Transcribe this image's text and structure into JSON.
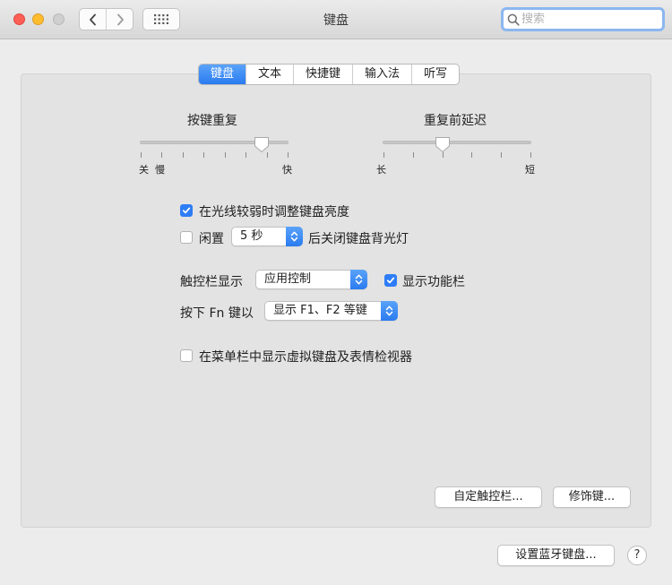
{
  "window": {
    "title": "键盘"
  },
  "toolbar": {
    "back_icon": "chevron-left-icon",
    "forward_icon": "chevron-right-icon",
    "grid_icon": "grid-icon",
    "search": {
      "placeholder": "搜索",
      "value": ""
    }
  },
  "tabs": [
    {
      "label": "键盘",
      "active": true
    },
    {
      "label": "文本",
      "active": false
    },
    {
      "label": "快捷键",
      "active": false
    },
    {
      "label": "输入法",
      "active": false
    },
    {
      "label": "听写",
      "active": false
    }
  ],
  "key_repeat": {
    "label": "按键重复",
    "min_label_1": "关",
    "min_label_2": "慢",
    "max_label": "快",
    "tick_count": 8,
    "selected_tick": 7
  },
  "delay_until_repeat": {
    "label": "重复前延迟",
    "min_label": "长",
    "max_label": "短",
    "tick_count": 6,
    "selected_tick": 2
  },
  "adjust_brightness": {
    "label": "在光线较弱时调整键盘亮度",
    "checked": true
  },
  "idle_backlight": {
    "prefix": "闲置",
    "value": "5 秒",
    "suffix": "后关闭键盘背光灯",
    "checked": false
  },
  "touch_bar": {
    "label": "触控栏显示",
    "value": "应用控制",
    "show_function_row": {
      "label": "显示功能栏",
      "checked": true
    }
  },
  "fn_key": {
    "label": "按下 Fn 键以",
    "value": "显示 F1、F2 等键"
  },
  "show_viewer": {
    "label": "在菜单栏中显示虚拟键盘及表情检视器",
    "checked": false
  },
  "buttons": {
    "customize_touch_bar": "自定触控栏...",
    "modifier_keys": "修饰键...",
    "bluetooth_keyboard": "设置蓝牙键盘...",
    "help": "?"
  },
  "colors": {
    "accent": "#2e7df6",
    "red": "#fd5f57",
    "yellow": "#febc2e"
  }
}
